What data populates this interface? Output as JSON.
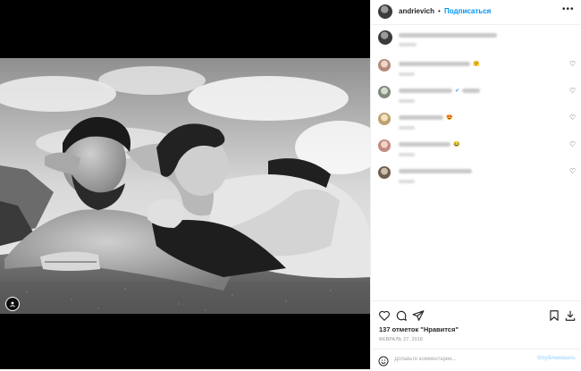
{
  "header": {
    "username": "andrievich",
    "separator": "•",
    "follow_label": "Подписаться",
    "more_label": "•••"
  },
  "comments": [
    {
      "emoji": "🤗"
    },
    {
      "emoji": "✔"
    },
    {
      "emoji": "😍"
    },
    {
      "emoji": "😂"
    },
    {
      "emoji": ""
    }
  ],
  "post": {
    "likes_text": "137 отметок \"Нравится\"",
    "date_text": "ФЕВРАЛЬ 27, 2018"
  },
  "comment_box": {
    "placeholder": "Добавьте комментарий...",
    "publish_label": "Опубликовать"
  },
  "colors": {
    "accent": "#0095f6",
    "publish_disabled": "#b3dbff",
    "text": "#262626",
    "muted": "#8e8e8e"
  },
  "icons": [
    "heart-icon",
    "comment-icon",
    "share-icon",
    "bookmark-icon",
    "download-icon",
    "smiley-icon",
    "user-tag-icon",
    "more-icon"
  ]
}
